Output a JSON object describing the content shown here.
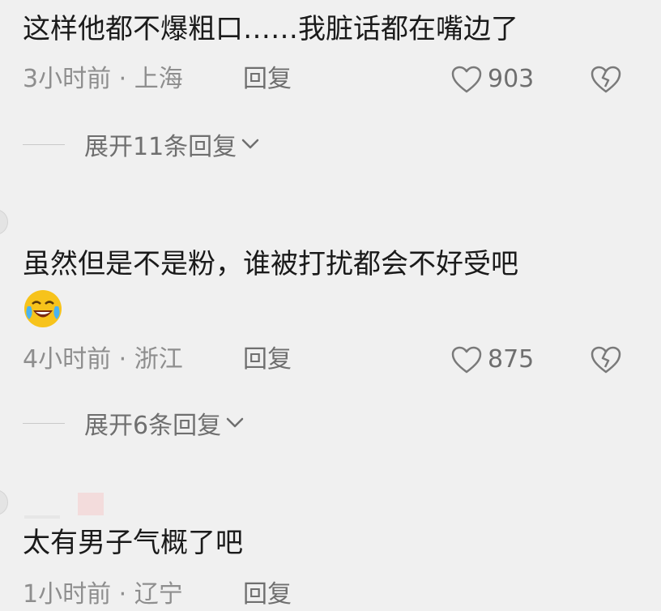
{
  "comments": [
    {
      "text": "这样他都不爆粗口……我脏话都在嘴边了",
      "time": "3小时前 · 上海",
      "reply": "回复",
      "likes": "903",
      "expand": "展开11条回复"
    },
    {
      "text": "虽然但是不是粉，谁被打扰都会不好受吧",
      "emoji": "laughing-crying-emoji",
      "time": "4小时前 · 浙江",
      "reply": "回复",
      "likes": "875",
      "expand": "展开6条回复"
    },
    {
      "text": "太有男子气概了吧",
      "time": "1小时前 · 辽宁",
      "reply": "回复"
    }
  ],
  "icons": {
    "like": "heart-outline-icon",
    "dislike": "broken-heart-icon",
    "expand": "chevron-down-icon"
  },
  "colors": {
    "background": "#f0f0f0",
    "text": "#1a1a1a",
    "meta": "#8e8e8e"
  }
}
